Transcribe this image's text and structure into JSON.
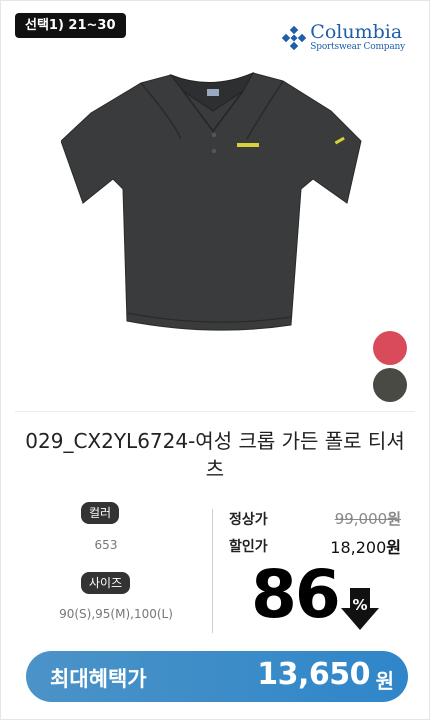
{
  "select_badge": "선택1) 21~30",
  "brand": {
    "name": "Columbia",
    "subtitle": "Sportswear Company",
    "color": "#1f5fa8"
  },
  "product": {
    "name": "029_CX2YL6724-여성 크롭 가든 폴로 티셔츠",
    "swatches": [
      {
        "color": "#d94a5a",
        "name": "red"
      },
      {
        "color": "#4a4a44",
        "name": "charcoal"
      }
    ]
  },
  "options": {
    "color_label": "컬러",
    "color_value": "653",
    "size_label": "사이즈",
    "size_value": "90(S),95(M),100(L)"
  },
  "pricing": {
    "regular_label": "정상가",
    "regular_value": "99,000",
    "sale_label": "할인가",
    "sale_value": "18,200",
    "currency": "원",
    "discount_rate": "86",
    "discount_symbol": "%"
  },
  "benefit": {
    "label": "최대혜택가",
    "amount": "13,650",
    "unit": "원",
    "color": "#3a8bc8"
  },
  "icons": {
    "brand_logo": "columbia-diamond-icon",
    "discount": "down-arrow-percent-icon"
  }
}
